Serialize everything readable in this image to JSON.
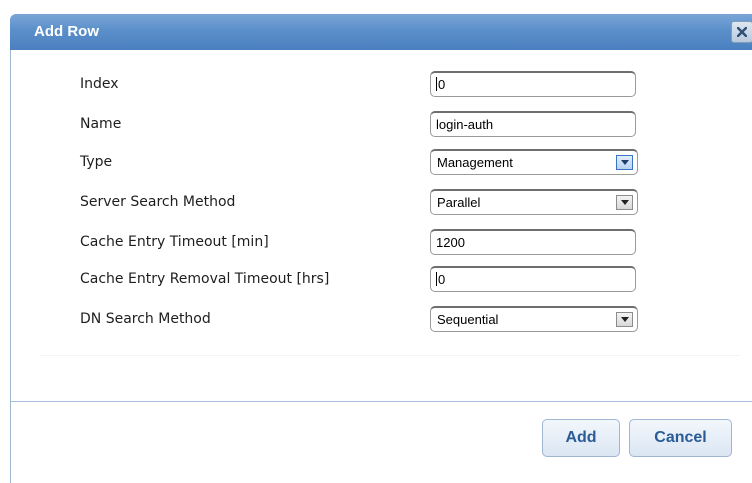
{
  "dialog": {
    "title": "Add Row",
    "close_icon": "close-x-icon"
  },
  "fields": {
    "index": {
      "label": "Index",
      "value": "0"
    },
    "name": {
      "label": "Name",
      "value": "login-auth"
    },
    "type": {
      "label": "Type",
      "value": "Management"
    },
    "server_search_method": {
      "label": "Server Search Method",
      "value": "Parallel"
    },
    "cache_entry_timeout": {
      "label": "Cache Entry Timeout [min]",
      "value": "1200"
    },
    "cache_entry_removal_timeout": {
      "label": "Cache Entry Removal Timeout [hrs]",
      "value": "0"
    },
    "dn_search_method": {
      "label": "DN Search Method",
      "value": "Sequential"
    }
  },
  "buttons": {
    "add": "Add",
    "cancel": "Cancel"
  },
  "colors": {
    "titlebar": "#5b8fca",
    "button_text": "#2a5b95",
    "separator": "#a9c0dc"
  }
}
